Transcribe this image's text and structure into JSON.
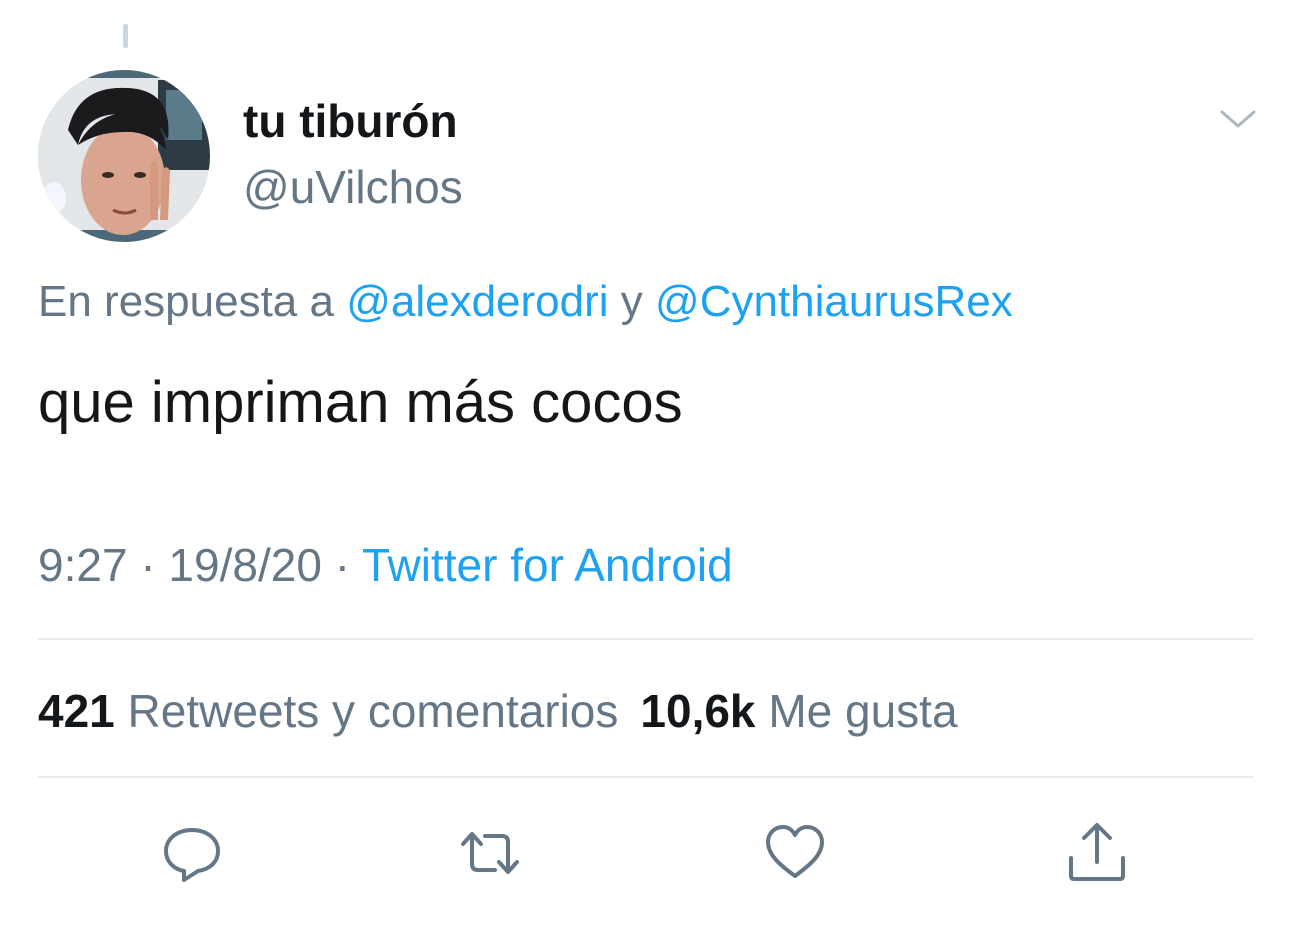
{
  "tweet": {
    "author": {
      "display_name": "tu tiburón",
      "handle": "@uVilchos"
    },
    "reply": {
      "prefix": "En respuesta a",
      "mention_1": "@alexderodri",
      "joiner": "y",
      "mention_2": "@CynthiaurusRex"
    },
    "text": "que impriman más cocos",
    "meta": {
      "time": "9:27",
      "separator": "·",
      "date": "19/8/20",
      "source": "Twitter for Android"
    },
    "stats": {
      "retweets_count": "421",
      "retweets_label": "Retweets y comentarios",
      "likes_count": "10,6k",
      "likes_label": "Me gusta"
    }
  },
  "actions": [
    "reply-icon",
    "retweet-icon",
    "like-icon",
    "share-icon"
  ],
  "colors": {
    "primary_text": "#14171a",
    "secondary_text": "#657786",
    "accent": "#1da1f2",
    "divider": "#e6ecf0",
    "icon": "#657786"
  }
}
